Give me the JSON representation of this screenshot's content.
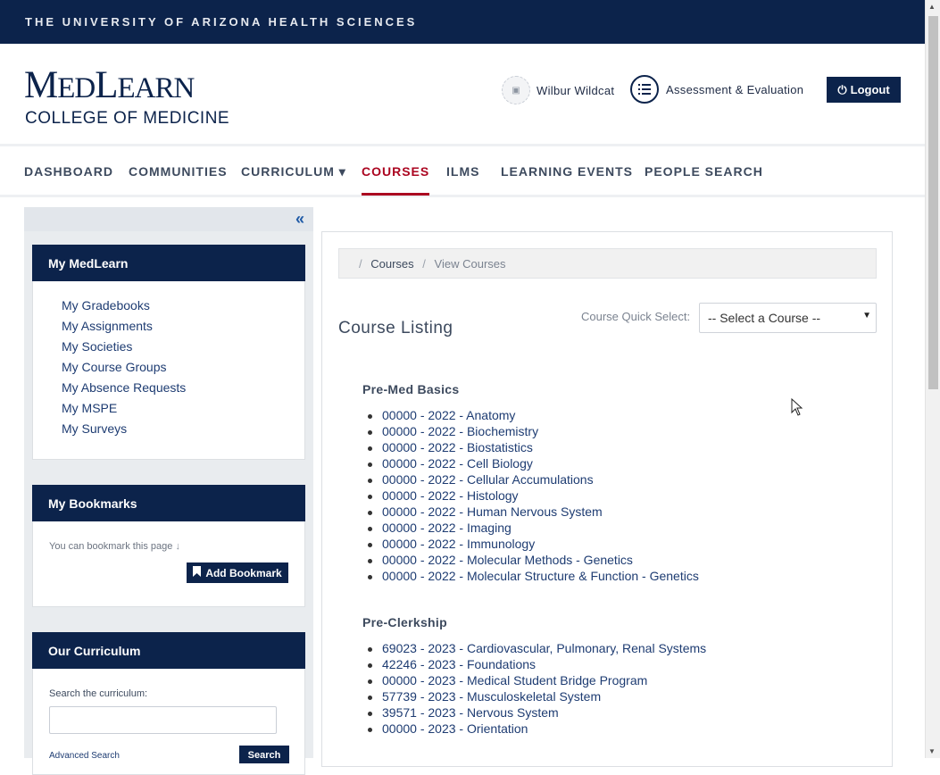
{
  "topbar": {
    "title": "THE UNIVERSITY OF ARIZONA HEALTH SCIENCES"
  },
  "logo": {
    "m": "M",
    "ed": "ED",
    "l": "L",
    "earn": "EARN",
    "subtitle": "COLLEGE OF MEDICINE"
  },
  "header": {
    "user_name": "Wilbur Wildcat",
    "assessment_label": "Assessment & Evaluation",
    "logout_label": "Logout"
  },
  "nav": {
    "items": [
      {
        "label": "DASHBOARD"
      },
      {
        "label": "COMMUNITIES"
      },
      {
        "label": "CURRICULUM ▾"
      },
      {
        "label": "COURSES"
      },
      {
        "label": "ILMS"
      },
      {
        "label": "LEARNING EVENTS"
      },
      {
        "label": "PEOPLE SEARCH"
      }
    ],
    "active_index": 3
  },
  "sidebar": {
    "my_medlearn": {
      "title": "My MedLearn",
      "links": [
        "My Gradebooks",
        "My Assignments",
        "My Societies",
        "My Course Groups",
        "My Absence Requests",
        "My MSPE",
        "My Surveys"
      ]
    },
    "bookmarks": {
      "title": "My Bookmarks",
      "hint": "You can bookmark this page",
      "button_label": "Add Bookmark"
    },
    "curriculum": {
      "title": "Our Curriculum",
      "search_label": "Search the curriculum:",
      "search_placeholder": "",
      "advanced_label": "Advanced Search",
      "search_button": "Search"
    }
  },
  "main": {
    "breadcrumb": {
      "sep": "/",
      "courses": "Courses",
      "current": "View Courses"
    },
    "title": "Course Listing",
    "quick_select_label": "Course Quick Select:",
    "quick_select_value": "-- Select a Course --",
    "groups": [
      {
        "title": "Pre-Med Basics",
        "courses": [
          "00000 - 2022 - Anatomy",
          "00000 - 2022 - Biochemistry",
          "00000 - 2022 - Biostatistics",
          "00000 - 2022 - Cell Biology",
          "00000 - 2022 - Cellular Accumulations",
          "00000 - 2022 - Histology",
          "00000 - 2022 - Human Nervous System",
          "00000 - 2022 - Imaging",
          "00000 - 2022 - Immunology",
          "00000 - 2022 - Molecular Methods - Genetics",
          "00000 - 2022 - Molecular Structure & Function - Genetics"
        ]
      },
      {
        "title": "Pre-Clerkship",
        "courses": [
          "69023 - 2023 - Cardiovascular, Pulmonary, Renal Systems",
          "42246 - 2023 - Foundations",
          "00000 - 2023 - Medical Student Bridge Program",
          "57739 - 2023 - Musculoskeletal System",
          "39571 - 2023 - Nervous System",
          "00000 - 2023 - Orientation"
        ]
      }
    ]
  },
  "colors": {
    "brand_navy": "#0c234b",
    "active_red": "#ab0520",
    "link_blue": "#1e3c72"
  }
}
